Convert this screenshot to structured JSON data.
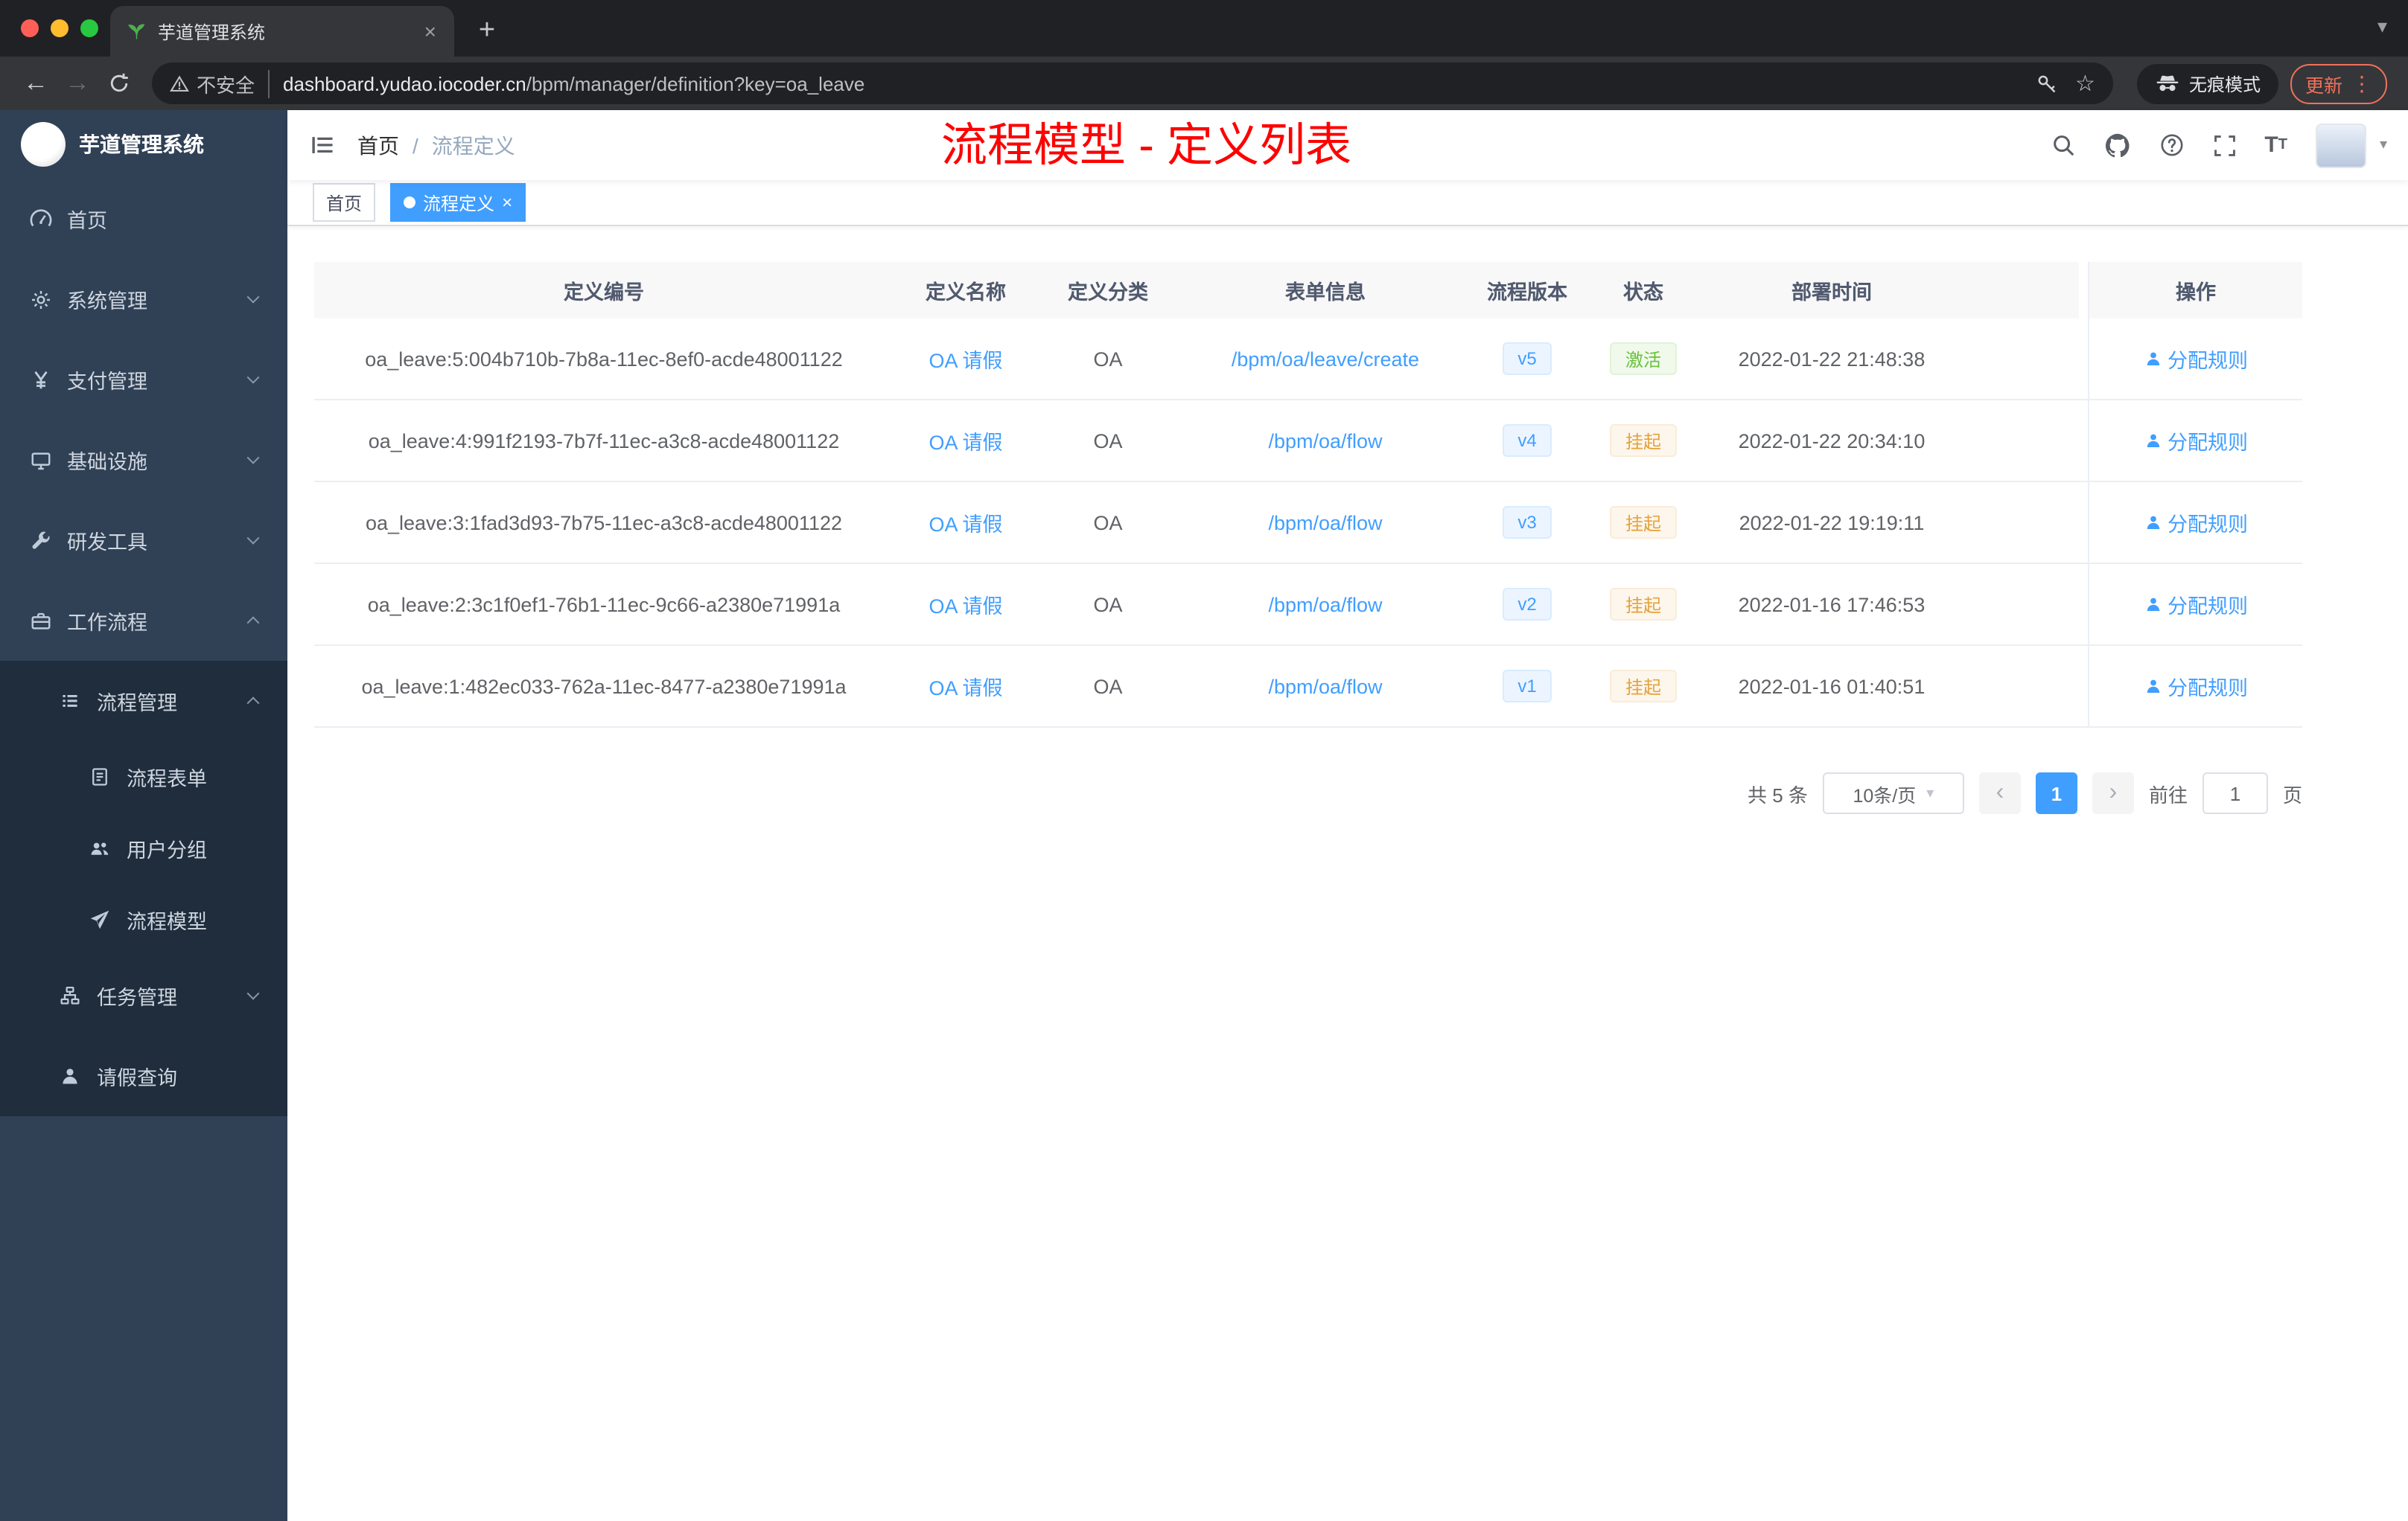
{
  "browser": {
    "tab_title": "芋道管理系统",
    "security_label": "不安全",
    "url_domain": "dashboard.yudao.iocoder.cn",
    "url_path": "/bpm/manager/definition?key=oa_leave",
    "incognito_label": "无痕模式",
    "update_label": "更新"
  },
  "sidebar": {
    "logo_title": "芋道管理系统",
    "items": [
      {
        "label": "首页"
      },
      {
        "label": "系统管理"
      },
      {
        "label": "支付管理"
      },
      {
        "label": "基础设施"
      },
      {
        "label": "研发工具"
      },
      {
        "label": "工作流程"
      },
      {
        "label": "流程管理"
      },
      {
        "label": "流程表单"
      },
      {
        "label": "用户分组"
      },
      {
        "label": "流程模型"
      },
      {
        "label": "任务管理"
      },
      {
        "label": "请假查询"
      }
    ]
  },
  "navbar": {
    "breadcrumb_home": "首页",
    "breadcrumb_separator": "/",
    "breadcrumb_current": "流程定义",
    "annotation": "流程模型 - 定义列表"
  },
  "tags": {
    "home": "首页",
    "active": "流程定义"
  },
  "table": {
    "columns": [
      "定义编号",
      "定义名称",
      "定义分类",
      "表单信息",
      "流程版本",
      "状态",
      "部署时间",
      "操作"
    ],
    "rows": [
      {
        "id": "oa_leave:5:004b710b-7b8a-11ec-8ef0-acde48001122",
        "name": "OA 请假",
        "category": "OA",
        "form": "/bpm/oa/leave/create",
        "version": "v5",
        "status": "激活",
        "time": "2022-01-22 21:48:38",
        "action": "分配规则"
      },
      {
        "id": "oa_leave:4:991f2193-7b7f-11ec-a3c8-acde48001122",
        "name": "OA 请假",
        "category": "OA",
        "form": "/bpm/oa/flow",
        "version": "v4",
        "status": "挂起",
        "time": "2022-01-22 20:34:10",
        "action": "分配规则"
      },
      {
        "id": "oa_leave:3:1fad3d93-7b75-11ec-a3c8-acde48001122",
        "name": "OA 请假",
        "category": "OA",
        "form": "/bpm/oa/flow",
        "version": "v3",
        "status": "挂起",
        "time": "2022-01-22 19:19:11",
        "action": "分配规则"
      },
      {
        "id": "oa_leave:2:3c1f0ef1-76b1-11ec-9c66-a2380e71991a",
        "name": "OA 请假",
        "category": "OA",
        "form": "/bpm/oa/flow",
        "version": "v2",
        "status": "挂起",
        "time": "2022-01-16 17:46:53",
        "action": "分配规则"
      },
      {
        "id": "oa_leave:1:482ec033-762a-11ec-8477-a2380e71991a",
        "name": "OA 请假",
        "category": "OA",
        "form": "/bpm/oa/flow",
        "version": "v1",
        "status": "挂起",
        "time": "2022-01-16 01:40:51",
        "action": "分配规则"
      }
    ]
  },
  "pagination": {
    "total": "共 5 条",
    "page_size": "10条/页",
    "current_page": "1",
    "goto_label": "前往",
    "goto_value": "1",
    "unit_label": "页"
  },
  "icons": {
    "close": "×",
    "plus": "+",
    "back": "←",
    "forward": "→",
    "more": "⋮",
    "caret_down": "▾",
    "star": "☆",
    "prev": "‹",
    "next": "›"
  },
  "colors": {
    "accent": "#409eff",
    "success": "#67c23a",
    "warning": "#e6a23c",
    "annotation_red": "#fd0000",
    "sidebar_bg": "#304156",
    "submenu_bg": "#1f2d3d"
  }
}
